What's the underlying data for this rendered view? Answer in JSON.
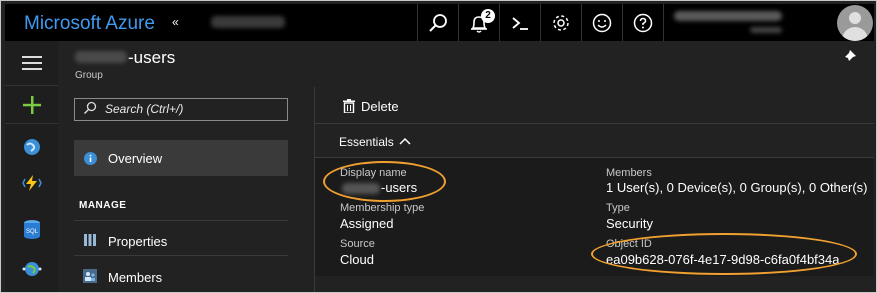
{
  "header": {
    "brand": "Microsoft Azure",
    "brand_chevron": "«",
    "notification_count": "2",
    "icons": [
      "search-icon",
      "bell-icon",
      "cloud-shell-icon",
      "gear-icon",
      "smiley-icon",
      "help-icon"
    ]
  },
  "leftnav": {
    "items": [
      "hamburger-icon",
      "plus-icon",
      "globe-icon",
      "lightning-icon",
      "sql-icon",
      "world-icon"
    ]
  },
  "blade": {
    "title_suffix": "-users",
    "subtitle": "Group"
  },
  "menu": {
    "search_placeholder": "Search (Ctrl+/)",
    "overview": "Overview",
    "section_manage": "MANAGE",
    "properties": "Properties",
    "members": "Members"
  },
  "command_bar": {
    "delete": "Delete"
  },
  "essentials": {
    "label": "Essentials",
    "chevron": "^",
    "display_name_key": "Display name",
    "display_name_suffix": "-users",
    "membership_type_key": "Membership type",
    "membership_type_value": "Assigned",
    "source_key": "Source",
    "source_value": "Cloud",
    "members_key": "Members",
    "members_value": "1 User(s), 0 Device(s), 0 Group(s), 0 Other(s)",
    "type_key": "Type",
    "type_value": "Security",
    "object_id_key": "Object ID",
    "object_id_value": "ea09b628-076f-4e17-9d98-c6fa0f4bf34a"
  },
  "colors": {
    "brand_blue": "#3f9bf0",
    "highlight_ring": "#f0a030",
    "topbar": "#000000",
    "panel": "#222222"
  }
}
